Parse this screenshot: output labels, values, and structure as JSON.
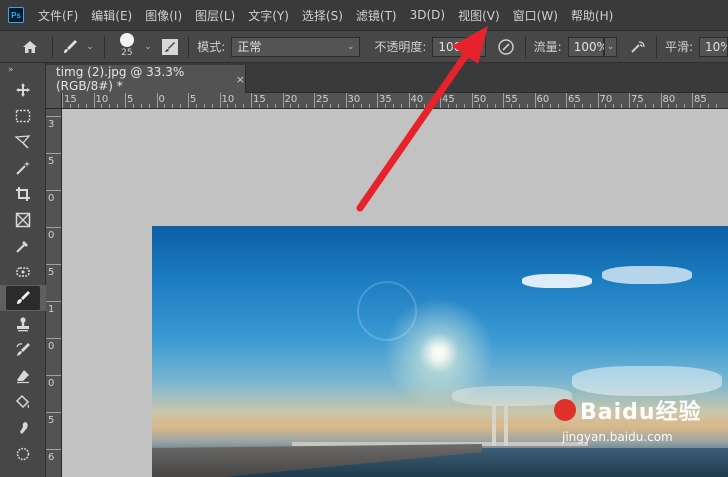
{
  "app": {
    "logo_text": "Ps"
  },
  "menu": {
    "items": [
      "文件(F)",
      "编辑(E)",
      "图像(I)",
      "图层(L)",
      "文字(Y)",
      "选择(S)",
      "滤镜(T)",
      "3D(D)",
      "视图(V)",
      "窗口(W)",
      "帮助(H)"
    ]
  },
  "options": {
    "brush_size": "25",
    "mode_label": "模式:",
    "mode_value": "正常",
    "opacity_label": "不透明度:",
    "opacity_value": "100%",
    "flow_label": "流量:",
    "flow_value": "100%",
    "smoothing_label": "平滑:",
    "smoothing_value": "10%"
  },
  "toolbar": {
    "collapse": "»",
    "tools": [
      "move-icon",
      "marquee-icon",
      "lasso-icon",
      "magic-wand-icon",
      "crop-icon",
      "frame-icon",
      "eyedropper-icon",
      "healing-icon",
      "brush-icon",
      "stamp-icon",
      "history-brush-icon",
      "eraser-icon",
      "paint-bucket-icon",
      "smudge-icon",
      "dodge-icon"
    ],
    "active_tool": "brush-icon"
  },
  "document": {
    "tab_title": "timg (2).jpg @ 33.3%(RGB/8#) *",
    "close": "×"
  },
  "ruler": {
    "top_labels": [
      "15",
      "10",
      "5",
      "0",
      "5",
      "10",
      "15",
      "20",
      "25",
      "30",
      "35",
      "40",
      "45",
      "50",
      "55",
      "60",
      "65",
      "70",
      "75",
      "80",
      "85"
    ],
    "left_labels": [
      "3",
      "5",
      "0",
      "0",
      "5",
      "1",
      "0",
      "0",
      "5",
      "6"
    ]
  },
  "watermark": {
    "main": "Baidu经验",
    "sub": "jingyan.baidu.com"
  },
  "colors": {
    "menubar": "#3a3a3a",
    "options": "#474747",
    "canvas": "#c2c2c2",
    "arrow": "#e8222c",
    "accent": "#31a8ff"
  }
}
